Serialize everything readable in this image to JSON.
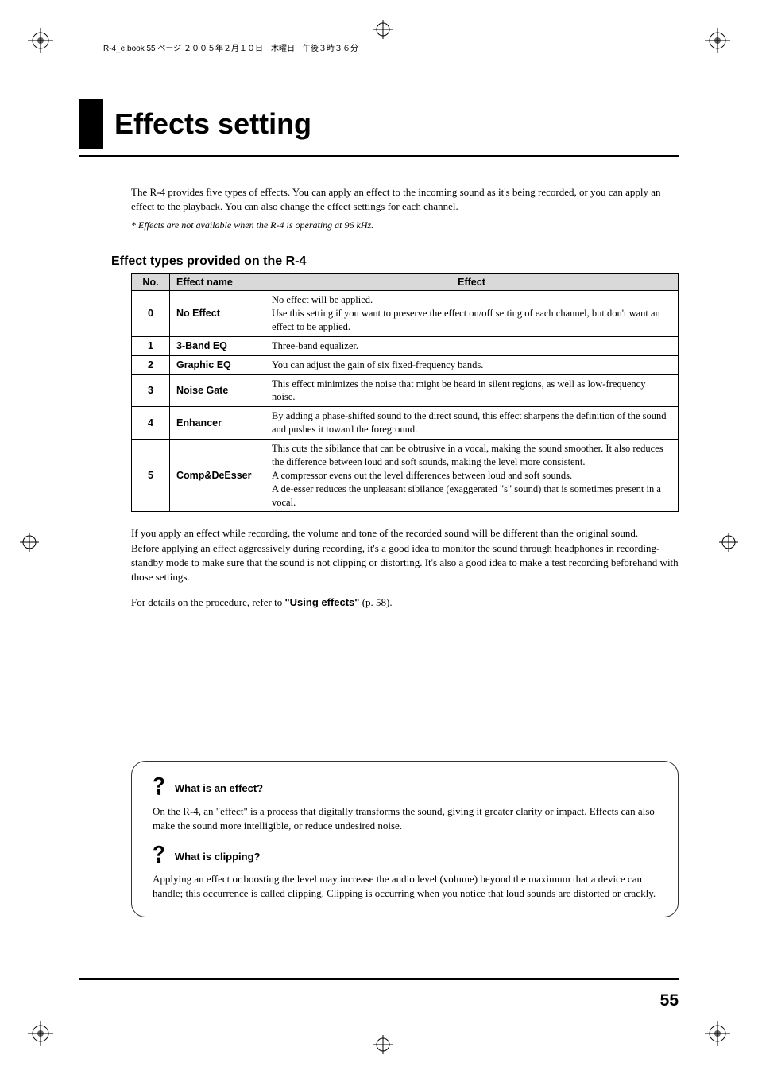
{
  "header": {
    "running": "R-4_e.book  55 ページ  ２００５年２月１０日　木曜日　午後３時３６分"
  },
  "title": "Effects setting",
  "intro": {
    "p1": "The R-4 provides five types of effects. You can apply an effect to the incoming sound as it's being recorded, or you can apply an effect to the playback. You can also change the effect settings for each channel.",
    "note": "* Effects are not available when the R-4 is operating at 96 kHz."
  },
  "section_heading": "Effect types provided on the R-4",
  "table": {
    "headers": {
      "no": "No.",
      "name": "Effect name",
      "effect": "Effect"
    },
    "rows": [
      {
        "no": "0",
        "name": "No Effect",
        "desc": "No effect will be applied.\nUse this setting if you want to preserve the effect on/off setting of each channel, but don't want an effect to be applied."
      },
      {
        "no": "1",
        "name": "3-Band EQ",
        "desc": "Three-band equalizer."
      },
      {
        "no": "2",
        "name": "Graphic EQ",
        "desc": "You can adjust the gain of six fixed-frequency bands."
      },
      {
        "no": "3",
        "name": "Noise Gate",
        "desc": "This effect minimizes the noise that might be heard in silent regions, as well as low-frequency noise."
      },
      {
        "no": "4",
        "name": "Enhancer",
        "desc": "By adding a phase-shifted sound to the direct sound, this effect sharpens the definition of the sound and pushes it toward the foreground."
      },
      {
        "no": "5",
        "name": "Comp&DeEsser",
        "desc": "This cuts the sibilance that can be obtrusive in a vocal, making the sound smoother. It also reduces the difference between loud and soft sounds, making the level more consistent.\nA compressor evens out the level differences between loud and soft sounds.\nA de-esser reduces the unpleasant sibilance (exaggerated \"s\" sound) that is sometimes present in a vocal."
      }
    ]
  },
  "post_table": {
    "p1": "If you apply an effect while recording, the volume and tone of the recorded sound will be different than the original sound.",
    "p2": "Before applying an effect aggressively during recording, it's a good idea to monitor the sound through headphones in recording-standby mode to make sure that the sound is not clipping or distorting. It's also a good idea to make a test recording beforehand with those settings.",
    "p3_pre": "For details on the procedure, refer to ",
    "p3_ref": "\"Using effects\"",
    "p3_post": " (p. 58)."
  },
  "infobox": {
    "q1_title": "What is an effect?",
    "q1_text": "On the R-4, an \"effect\" is a process that digitally transforms the sound, giving it greater clarity or impact. Effects can also make the sound more intelligible, or reduce undesired noise.",
    "q2_title": "What is clipping?",
    "q2_text": "Applying an effect or boosting the level may increase the audio level (volume) beyond the maximum that a device can handle; this occurrence is called clipping. Clipping is occurring when you notice that loud sounds are distorted or crackly."
  },
  "page_number": "55"
}
